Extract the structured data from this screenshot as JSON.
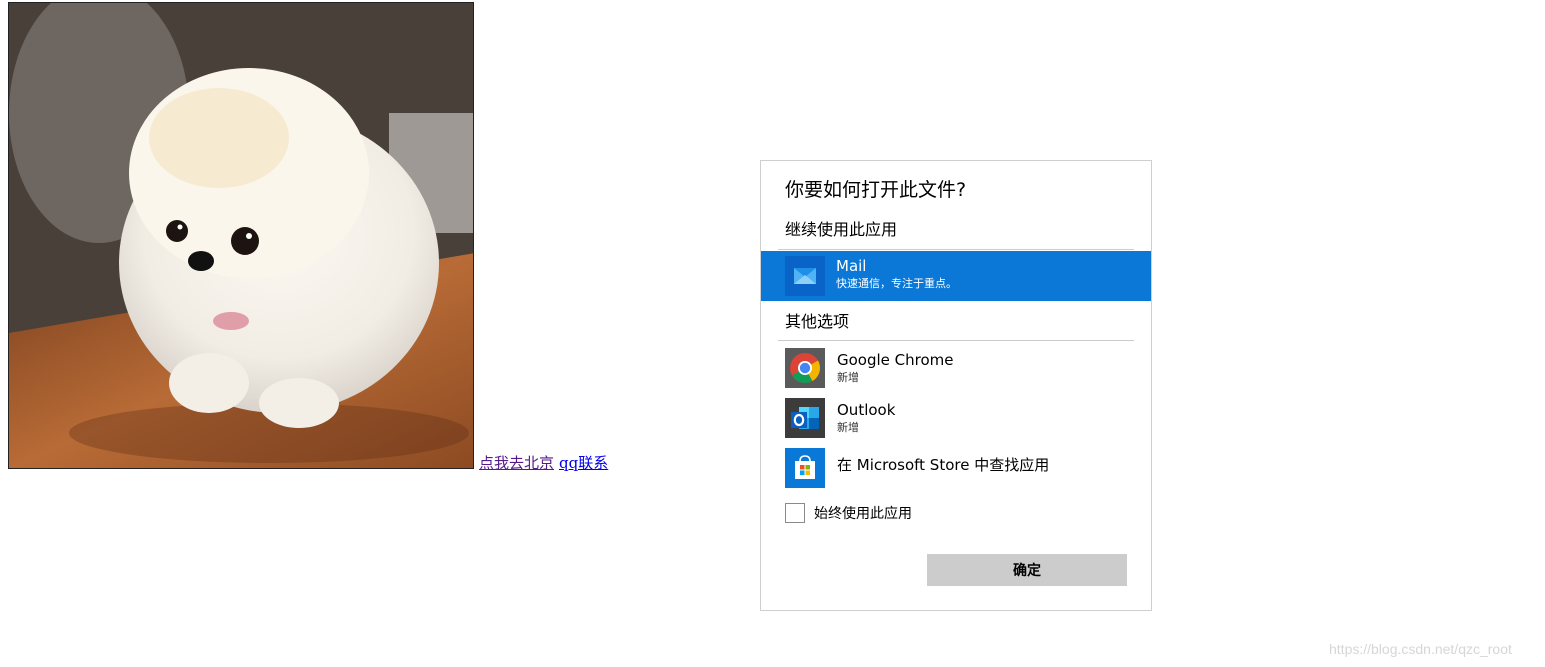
{
  "page": {
    "photo_subject": "white-pomeranian-puppy",
    "links": [
      {
        "label": "点我去北京",
        "visited": true
      },
      {
        "label": "qq联系",
        "visited": false
      }
    ],
    "watermark": "https://blog.csdn.net/qzc_root"
  },
  "dialog": {
    "title": "你要如何打开此文件?",
    "continue_section": "继续使用此应用",
    "current_app": {
      "name": "Mail",
      "description": "快速通信，专注于重点。",
      "icon": "mail-icon"
    },
    "other_section": "其他选项",
    "other_apps": [
      {
        "name": "Google Chrome",
        "sub": "新增",
        "icon": "chrome-icon"
      },
      {
        "name": "Outlook",
        "sub": "新增",
        "icon": "outlook-icon"
      },
      {
        "name": "在 Microsoft Store 中查找应用",
        "sub": "",
        "icon": "store-icon"
      }
    ],
    "always_use_label": "始终使用此应用",
    "always_use_checked": false,
    "ok_label": "确定"
  },
  "colors": {
    "selection": "#0b78d7",
    "ok_button": "#cccccc",
    "link": "#0000ee",
    "visited_link": "#551a8b",
    "divider": "#cccccc"
  }
}
